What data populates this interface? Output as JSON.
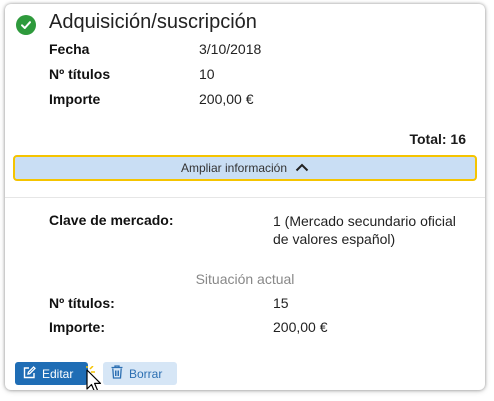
{
  "header": {
    "title": "Adquisición/suscripción",
    "status_icon": "check-circle-icon",
    "status_color": "#2e9a3c"
  },
  "summary": {
    "rows": [
      {
        "label": "Fecha",
        "value": "3/10/2018"
      },
      {
        "label": "Nº títulos",
        "value": "10"
      },
      {
        "label": "Importe",
        "value": "200,00 €"
      }
    ],
    "total": "Total:  16"
  },
  "expand_button": {
    "label": "Ampliar información",
    "icon": "chevron-up-icon",
    "border_color": "#f5c400"
  },
  "details": {
    "market_label": "Clave de mercado:",
    "market_value": "1 (Mercado secundario oficial de valores español)",
    "situation_heading": "Situación actual",
    "situation_rows": [
      {
        "label": "Nº títulos:",
        "value": "15"
      },
      {
        "label": "Importe:",
        "value": "200,00 €"
      }
    ]
  },
  "actions": {
    "edit_label": "Editar",
    "edit_icon": "edit-icon",
    "delete_label": "Borrar",
    "delete_icon": "trash-icon",
    "edit_color": "#1f6db5",
    "delete_color": "#d6e6f6"
  }
}
